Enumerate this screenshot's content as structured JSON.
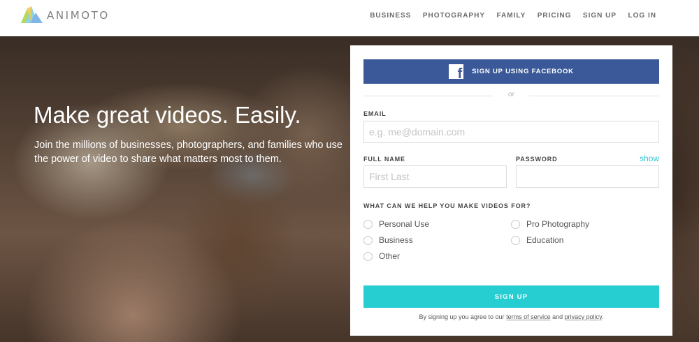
{
  "header": {
    "logo_text": "ANIMOTO",
    "nav": [
      "BUSINESS",
      "PHOTOGRAPHY",
      "FAMILY",
      "PRICING",
      "SIGN UP",
      "LOG IN"
    ]
  },
  "hero": {
    "title": "Make great videos. Easily.",
    "subtitle": "Join the millions of businesses, photographers, and families who use the power of video to share what matters most to them."
  },
  "signup": {
    "facebook_label": "SIGN UP USING FACEBOOK",
    "or_text": "or",
    "email_label": "EMAIL",
    "email_placeholder": "e.g. me@domain.com",
    "email_value": "",
    "fullname_label": "FULL NAME",
    "fullname_placeholder": "First Last",
    "fullname_value": "",
    "password_label": "PASSWORD",
    "password_value": "",
    "show_label": "show",
    "question": "WHAT CAN WE HELP YOU MAKE VIDEOS FOR?",
    "options": [
      "Personal Use",
      "Business",
      "Other",
      "Pro Photography",
      "Education"
    ],
    "submit_label": "SIGN UP",
    "terms_prefix": "By signing up you agree to our",
    "terms_link": "terms of service",
    "terms_and": "and",
    "privacy_link": "privacy policy",
    "terms_suffix": "."
  },
  "colors": {
    "facebook_blue": "#3b5998",
    "accent_teal": "#26cdd1",
    "link_teal": "#2ec3cf"
  },
  "icons": [
    "animoto-logo-icon",
    "facebook-icon"
  ]
}
